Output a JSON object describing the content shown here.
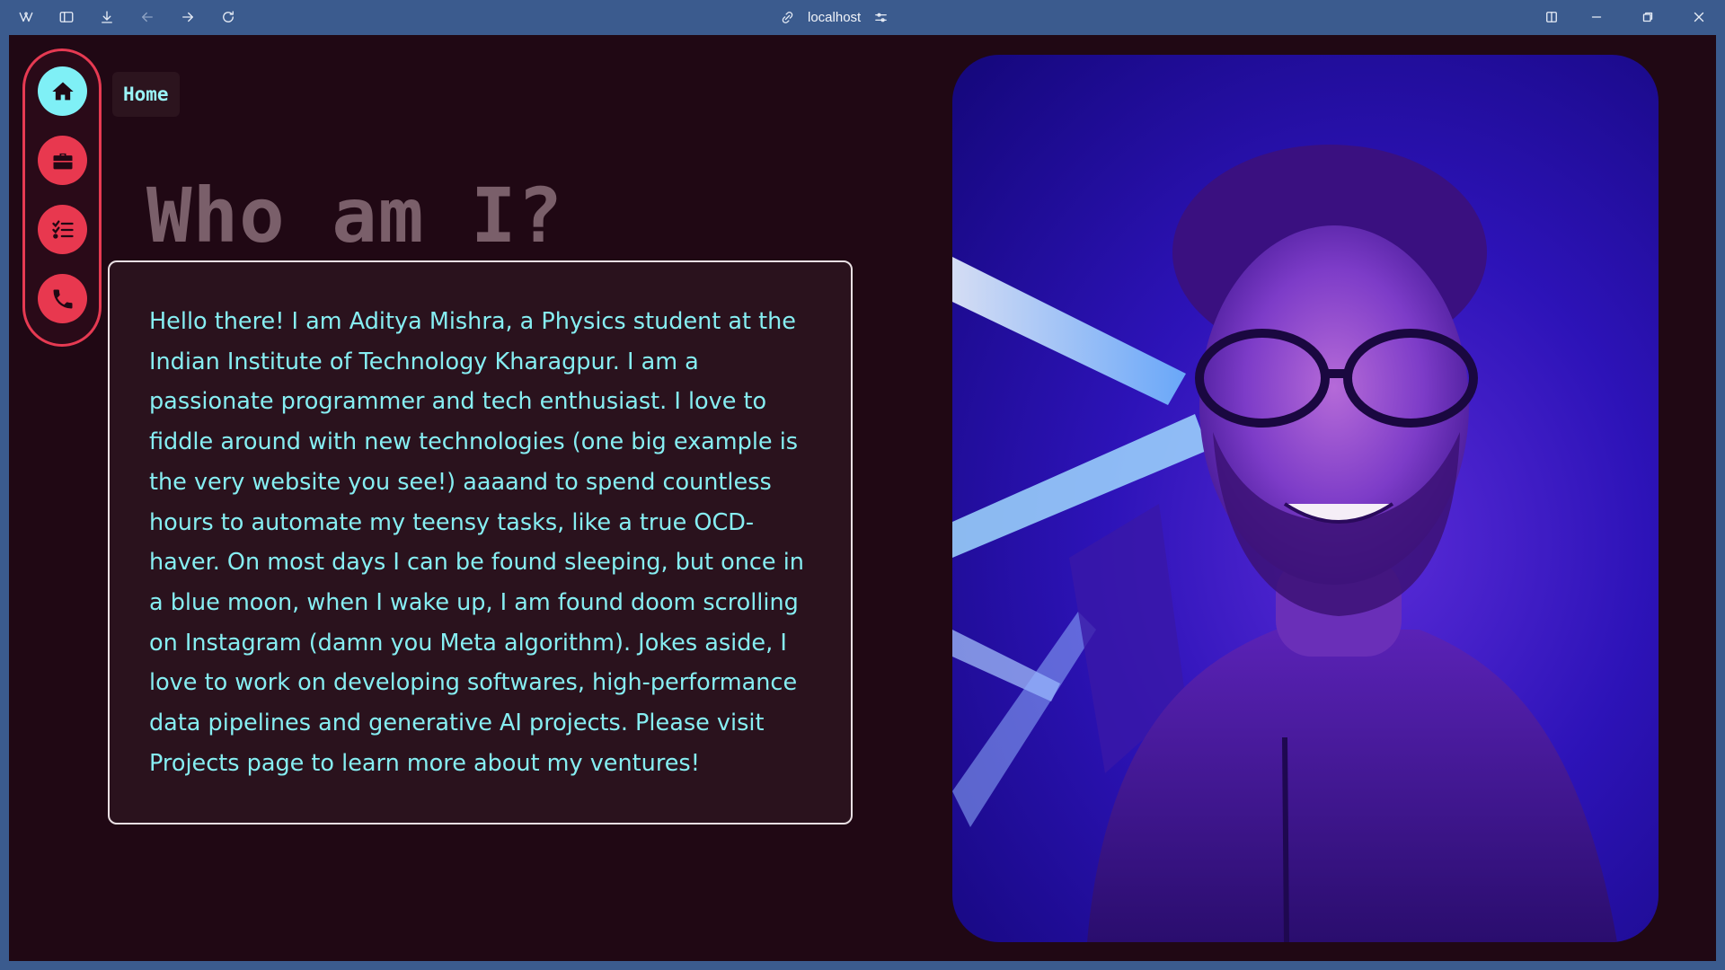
{
  "browser": {
    "address": "localhost",
    "icons": [
      "workspaces-icon",
      "sidebar-toggle-icon",
      "download-icon",
      "back-icon",
      "forward-icon",
      "reload-icon",
      "link-icon",
      "site-settings-icon",
      "split-view-icon",
      "minimize-icon",
      "restore-icon",
      "close-icon"
    ]
  },
  "sidebar": {
    "items": [
      {
        "icon": "home-icon",
        "active": true
      },
      {
        "icon": "briefcase-icon",
        "active": false
      },
      {
        "icon": "checklist-icon",
        "active": false
      },
      {
        "icon": "phone-icon",
        "active": false
      }
    ]
  },
  "page": {
    "chip": "Home",
    "heading": "Who am I?",
    "about": "Hello there! I am Aditya Mishra, a Physics student at the Indian Institute of Technology Kharagpur. I am a passionate programmer and tech enthusiast. I love to fiddle around with new technologies (one big example is the very website you see!) aaaand to spend countless hours to automate my teensy tasks, like a true OCD-haver. On most days I can be found sleeping, but once in a blue moon, when I wake up, I am found doom scrolling on Instagram (damn you Meta algorithm). Jokes aside, I love to work on developing softwares, high-performance data pipelines and generative AI projects. Please visit Projects page to learn more about my ventures!"
  },
  "colors": {
    "background": "#200814",
    "accent_red": "#e8384f",
    "accent_cyan": "#7ff0f6",
    "text_cyan": "#86eef2",
    "heading_gray": "#7a5f6a"
  }
}
